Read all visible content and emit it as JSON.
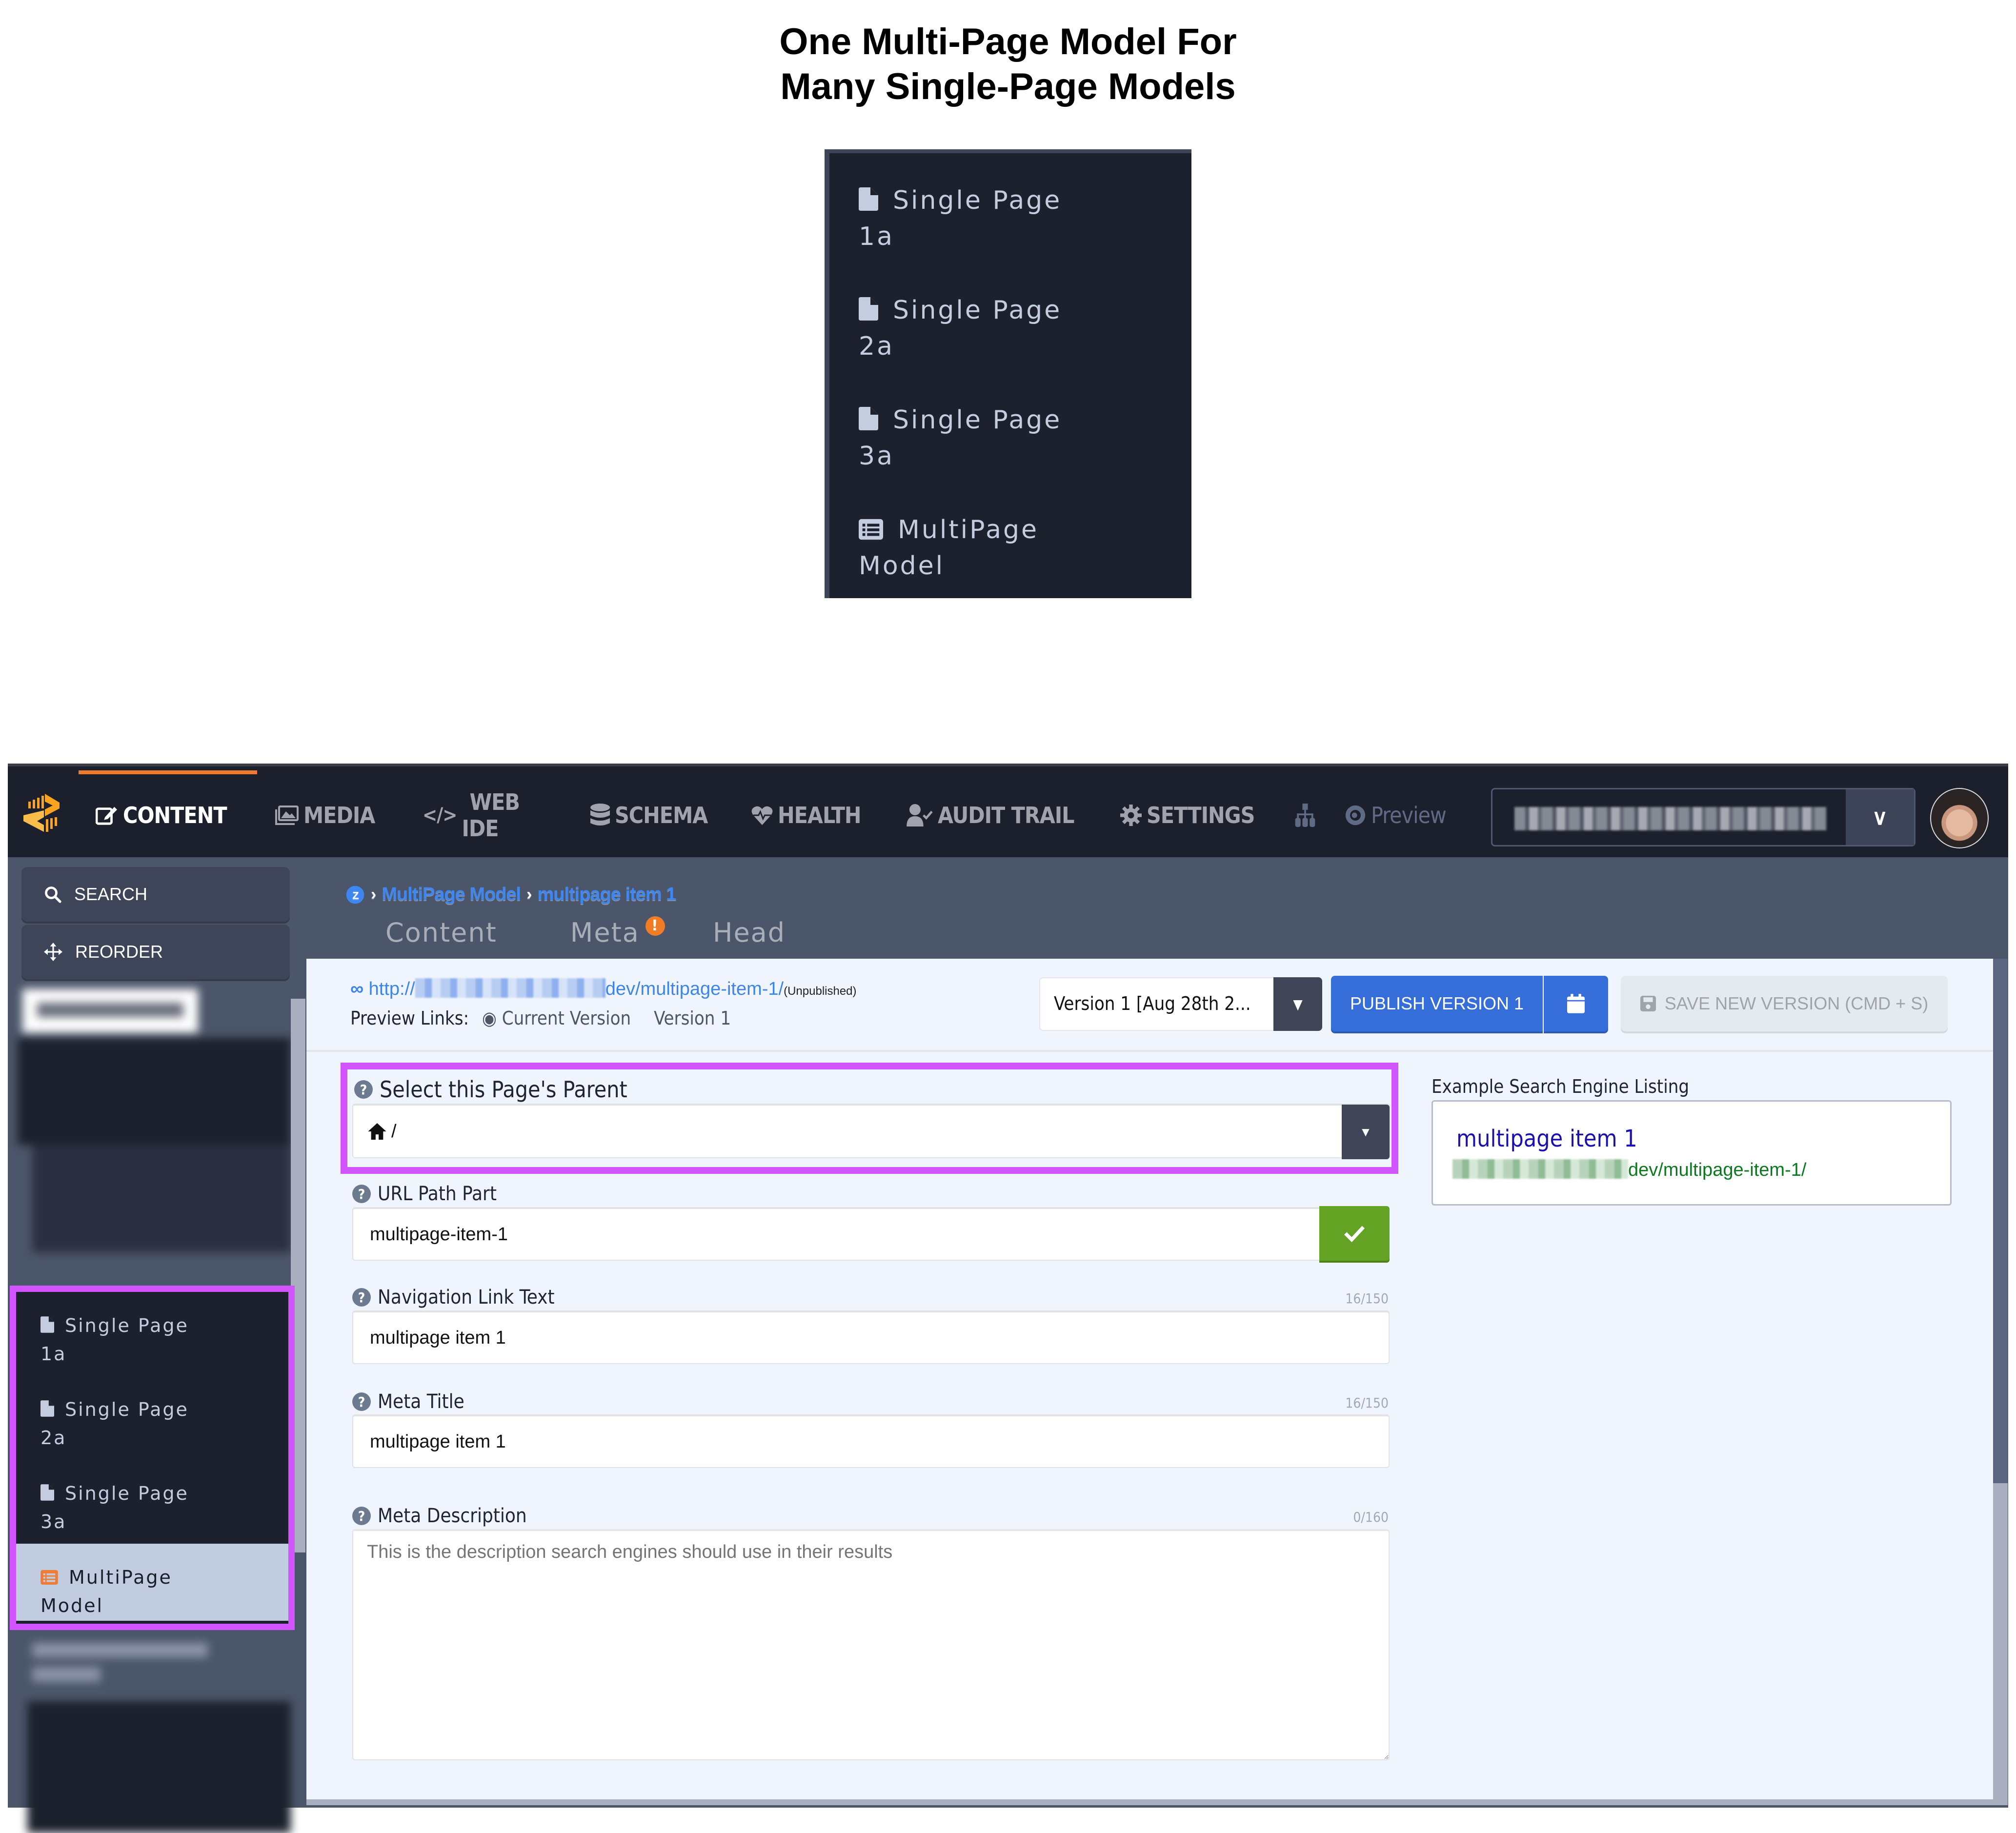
{
  "headline": {
    "line1": "One Multi-Page Model For",
    "line2": "Many Single-Page Models"
  },
  "illustration_nav": {
    "items": [
      {
        "icon": "file-icon",
        "line1": "Single Page",
        "line2": "1a"
      },
      {
        "icon": "file-icon",
        "line1": "Single Page",
        "line2": "2a"
      },
      {
        "icon": "file-icon",
        "line1": "Single Page",
        "line2": "3a"
      },
      {
        "icon": "list-icon",
        "line1": "MultiPage",
        "line2": "Model"
      }
    ]
  },
  "topbar": {
    "logo": "zesty-logo-icon",
    "nav": [
      {
        "icon": "edit-icon",
        "label": "CONTENT",
        "active": true
      },
      {
        "icon": "image-icon",
        "label": "MEDIA"
      },
      {
        "icon": "code-icon",
        "label_line1": "WEB",
        "label_line2": "IDE"
      },
      {
        "icon": "database-icon",
        "label": "SCHEMA"
      },
      {
        "icon": "heartbeat-icon",
        "label": "HEALTH"
      },
      {
        "icon": "user-check-icon",
        "label": "AUDIT TRAIL"
      },
      {
        "icon": "gear-icon",
        "label": "SETTINGS"
      },
      {
        "icon": "sitemap-icon",
        "label": ""
      },
      {
        "icon": "eye-icon",
        "label": "Preview"
      }
    ],
    "accent_color": "#ee7a2e",
    "instance_selector": {
      "value": "[blurred instance name]",
      "toggle_icon": "chevron-down-icon"
    },
    "avatar": "user-avatar"
  },
  "sidebar": {
    "search_label": "SEARCH",
    "reorder_label": "REORDER",
    "items": [
      {
        "icon": "file-icon",
        "line1": "Single Page",
        "line2": "1a"
      },
      {
        "icon": "file-icon",
        "line1": "Single Page",
        "line2": "2a"
      },
      {
        "icon": "file-icon",
        "line1": "Single Page",
        "line2": "3a"
      },
      {
        "icon": "list-icon",
        "line1": "MultiPage",
        "line2": "Model",
        "selected": true
      }
    ],
    "highlight_color": "#d254ff"
  },
  "breadcrumb": {
    "items": [
      "MultiPage Model",
      "multipage item 1"
    ]
  },
  "tabs": [
    {
      "label": "Content"
    },
    {
      "label": "Meta",
      "badge": "!"
    },
    {
      "label": "Head"
    }
  ],
  "url_info": {
    "prefix": "http://",
    "suffix": "dev/multipage-item-1/",
    "status": "(Unpublished)",
    "preview_label": "Preview Links:",
    "preview_current": "Current Version",
    "preview_version": "Version 1"
  },
  "version_bar": {
    "version_select": "Version 1 [Aug 28th 2...",
    "publish_label": "PUBLISH VERSION 1",
    "save_label": "SAVE NEW VERSION (CMD + S)"
  },
  "form": {
    "parent": {
      "label": "Select this Page's Parent",
      "value": "/"
    },
    "url_path": {
      "label": "URL Path Part",
      "value": "multipage-item-1"
    },
    "nav_text": {
      "label": "Navigation Link Text",
      "value": "multipage item 1",
      "counter": "16/150"
    },
    "meta_title": {
      "label": "Meta Title",
      "value": "multipage item 1",
      "counter": "16/150"
    },
    "meta_description": {
      "label": "Meta Description",
      "placeholder": "This is the description search engines should use in their results",
      "value": "",
      "counter": "0/160"
    }
  },
  "seo_preview": {
    "label": "Example Search Engine Listing",
    "title": "multipage item 1",
    "url_suffix": "dev/multipage-item-1/"
  }
}
